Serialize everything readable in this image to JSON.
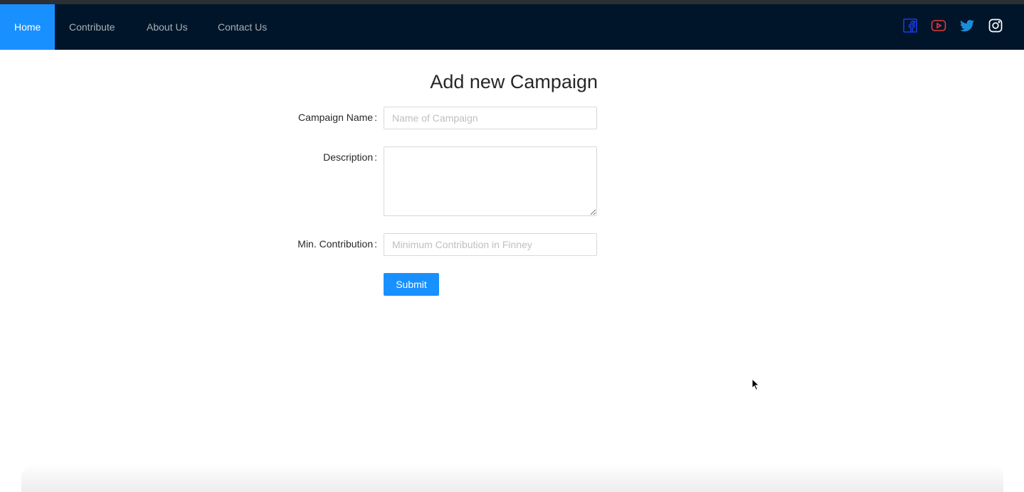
{
  "nav": {
    "items": [
      {
        "label": "Home",
        "active": true
      },
      {
        "label": "Contribute",
        "active": false
      },
      {
        "label": "About Us",
        "active": false
      },
      {
        "label": "Contact Us",
        "active": false
      }
    ],
    "social": [
      {
        "icon": "facebook-icon",
        "color": "#1a3be8"
      },
      {
        "icon": "youtube-icon",
        "color": "#e53935"
      },
      {
        "icon": "twitter-icon",
        "color": "#1d8cd8"
      },
      {
        "icon": "instagram-icon",
        "color": "#ffffff"
      }
    ]
  },
  "form": {
    "title": "Add new Campaign",
    "fields": {
      "name": {
        "label": "Campaign Name",
        "placeholder": "Name of Campaign",
        "value": ""
      },
      "description": {
        "label": "Description",
        "placeholder": "",
        "value": ""
      },
      "min_contribution": {
        "label": "Min. Contribution",
        "placeholder": "Minimum Contribution in Finney",
        "value": ""
      }
    },
    "colon": ":",
    "submit_label": "Submit"
  },
  "colors": {
    "navbar_bg": "#001529",
    "primary": "#1890ff"
  }
}
